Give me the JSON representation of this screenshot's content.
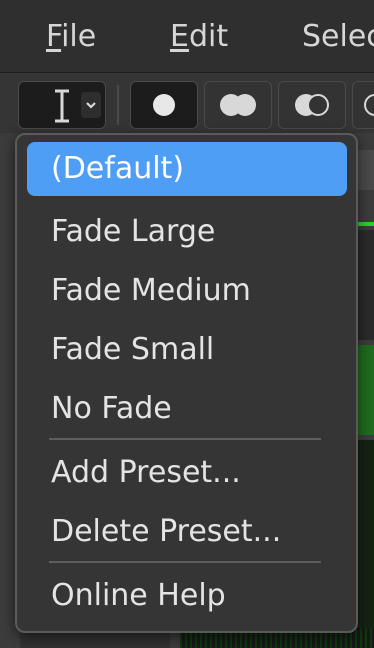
{
  "menubar": {
    "file": {
      "mnemonic": "F",
      "rest": "ile"
    },
    "edit": {
      "mnemonic": "E",
      "rest": "dit"
    },
    "select": {
      "text": "Selec"
    }
  },
  "toolbar": {
    "tool_icon": "text-cursor-icon",
    "dropdown_icon": "chevron-down-icon",
    "fade_buttons": [
      "fade-default-icon",
      "fade-large-icon",
      "fade-medium-icon",
      "fade-small-icon"
    ]
  },
  "popup_menu": {
    "items": [
      {
        "label": "(Default)",
        "selected": true
      },
      {
        "label": "Fade Large"
      },
      {
        "label": "Fade Medium"
      },
      {
        "label": "Fade Small"
      },
      {
        "label": "No Fade"
      },
      {
        "label": "Add Preset..."
      },
      {
        "label": "Delete Preset..."
      },
      {
        "label": "Online Help"
      }
    ]
  },
  "colors": {
    "selection": "#4f9ef5",
    "menu_bg": "#353535",
    "waveform_green": "#2bd12b"
  }
}
